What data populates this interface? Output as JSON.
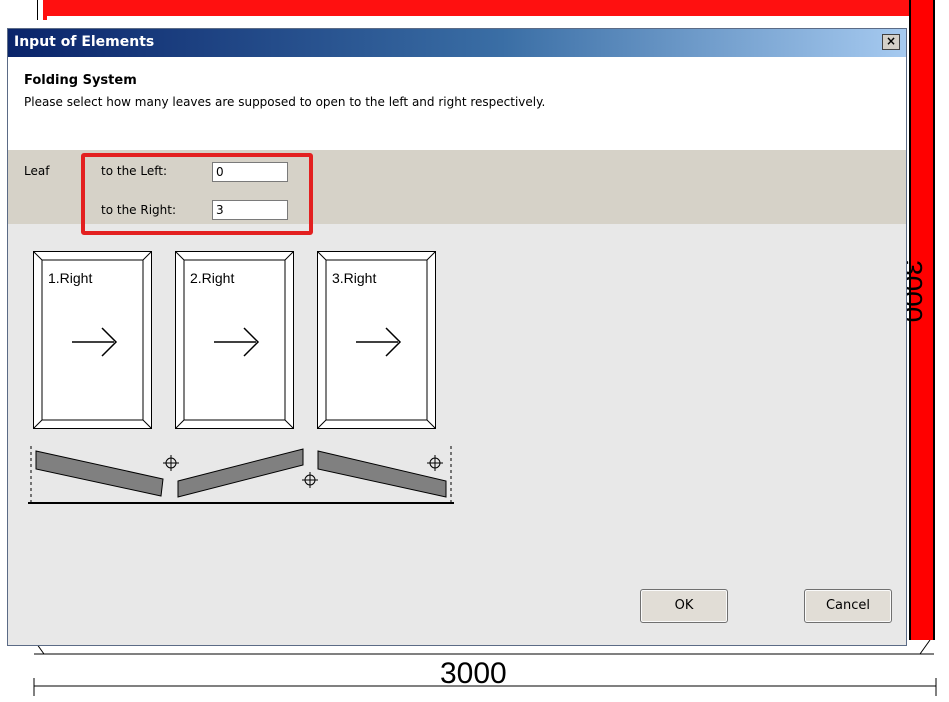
{
  "background": {
    "dimension_bottom": "3000",
    "dimension_right": "3000",
    "accent": "#ff0000"
  },
  "dialog": {
    "title": "Input of Elements",
    "close_glyph": "×",
    "header_title": "Folding System",
    "header_description": "Please select how many leaves are supposed to open to the left and right respectively.",
    "leaf_label": "Leaf",
    "left_label": "to the Left:",
    "left_value": "0",
    "right_label": "to the Right:",
    "right_value": "3",
    "leaves": [
      "1.Right",
      "2.Right",
      "3.Right"
    ],
    "ok_label": "OK",
    "cancel_label": "Cancel",
    "highlight_color": "#e32020",
    "title_color": "#0a246a"
  }
}
